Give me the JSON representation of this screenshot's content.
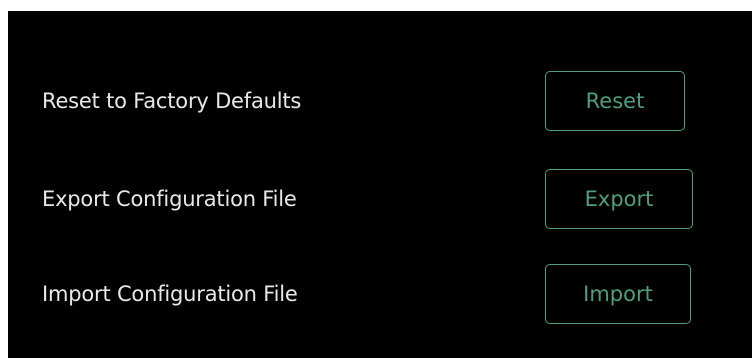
{
  "settings": {
    "rows": [
      {
        "label": "Reset to Factory Defaults",
        "button_label": "Reset"
      },
      {
        "label": "Export Configuration File",
        "button_label": "Export"
      },
      {
        "label": "Import Configuration File",
        "button_label": "Import"
      }
    ]
  },
  "colors": {
    "background": "#000000",
    "text": "#e8e8e8",
    "accent": "#4e9d85"
  }
}
